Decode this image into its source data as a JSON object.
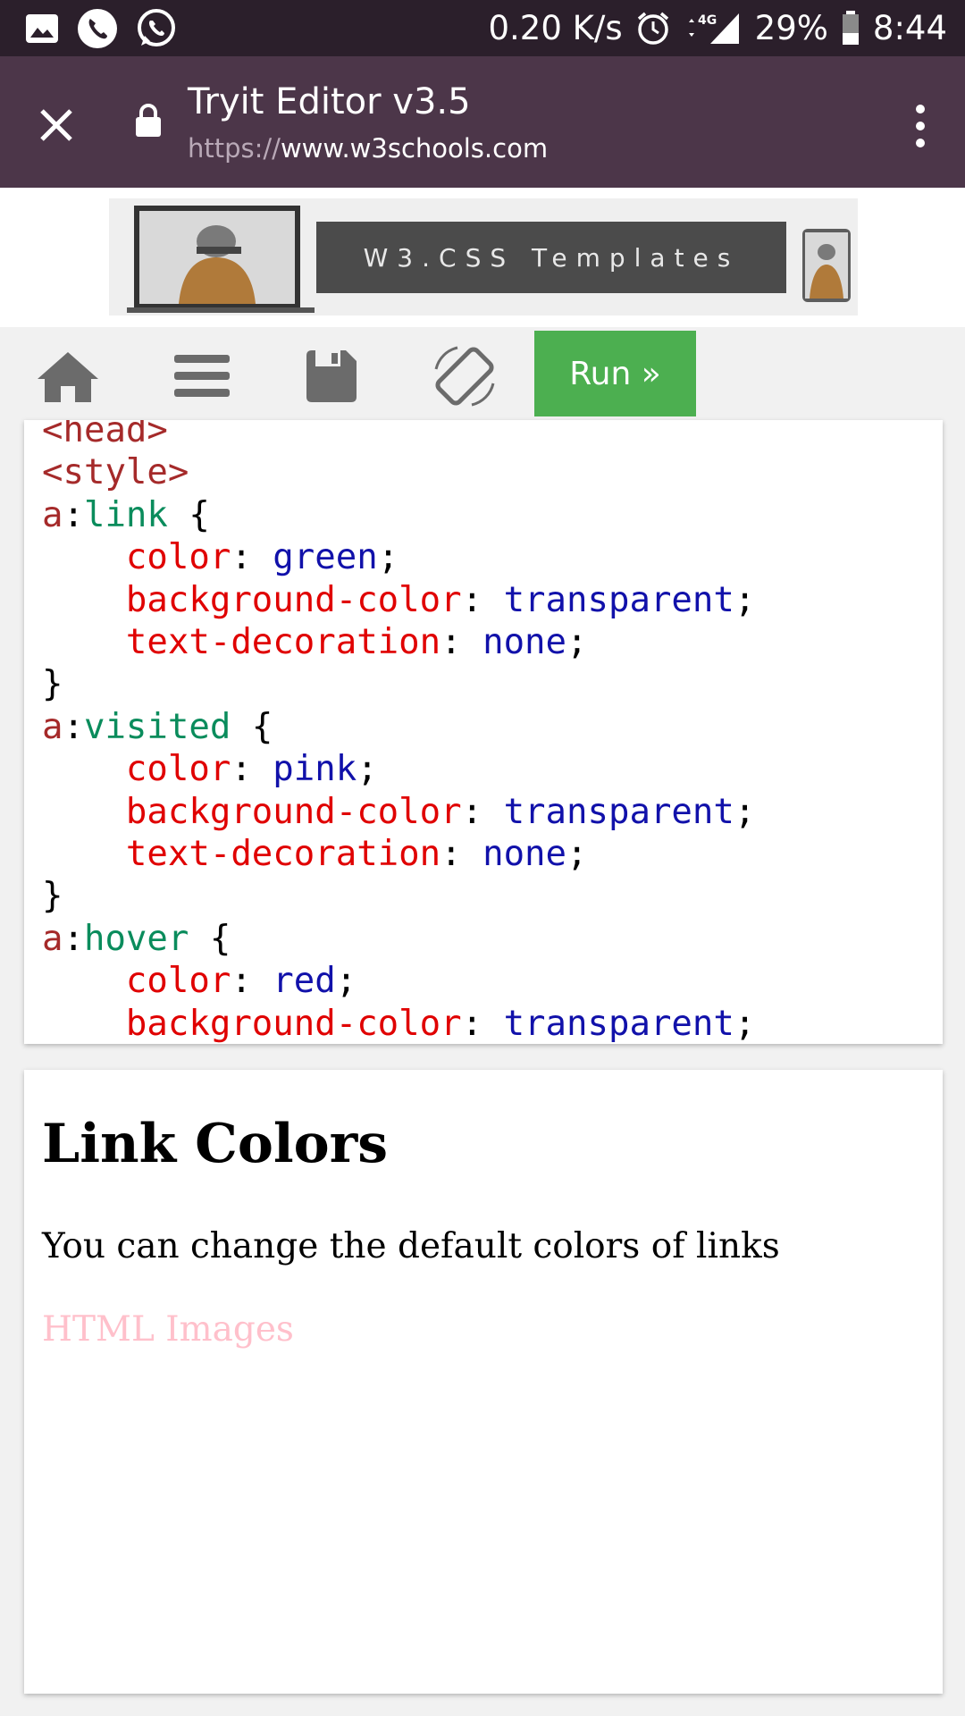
{
  "status_bar": {
    "network_speed": "0.20 K/s",
    "network_type": "4G",
    "battery": "29%",
    "time": "8:44",
    "icons": [
      "gallery-icon",
      "phone-icon",
      "whatsapp-icon",
      "alarm-icon",
      "signal-icon",
      "battery-icon"
    ]
  },
  "browser": {
    "title": "Tryit Editor v3.5",
    "url_scheme": "https://",
    "url_host": "www.w3schools.com",
    "colors": {
      "toolbar": "#4c3649",
      "status_bar": "#2b1f2b"
    }
  },
  "ad": {
    "banner_text": "W3.CSS Templates"
  },
  "toolbar": {
    "run_label": "Run »",
    "icons": [
      "home-icon",
      "menu-icon",
      "save-icon",
      "rotate-icon"
    ],
    "run_color": "#4caf50"
  },
  "code": {
    "lines": [
      {
        "a": "<",
        "b": "head",
        "c": ">"
      },
      {
        "a": "<",
        "b": "style",
        "c": ">"
      },
      {
        "sel": "a",
        "ps": "link"
      },
      {
        "prop": "color",
        "val": "green"
      },
      {
        "prop": "background-color",
        "val": "transparent"
      },
      {
        "prop": "text-decoration",
        "val": "none"
      },
      {
        "close": "}"
      },
      {
        "sel": "a",
        "ps": "visited"
      },
      {
        "prop": "color",
        "val": "pink"
      },
      {
        "prop": "background-color",
        "val": "transparent"
      },
      {
        "prop": "text-decoration",
        "val": "none"
      },
      {
        "close": "}"
      },
      {
        "sel": "a",
        "ps": "hover"
      },
      {
        "prop": "color",
        "val": "red"
      },
      {
        "prop": "background-color",
        "val": "transparent"
      }
    ]
  },
  "result": {
    "heading": "Link Colors",
    "paragraph": "You can change the default colors of links",
    "link_text": "HTML Images",
    "link_color": "#ffc0cb"
  }
}
